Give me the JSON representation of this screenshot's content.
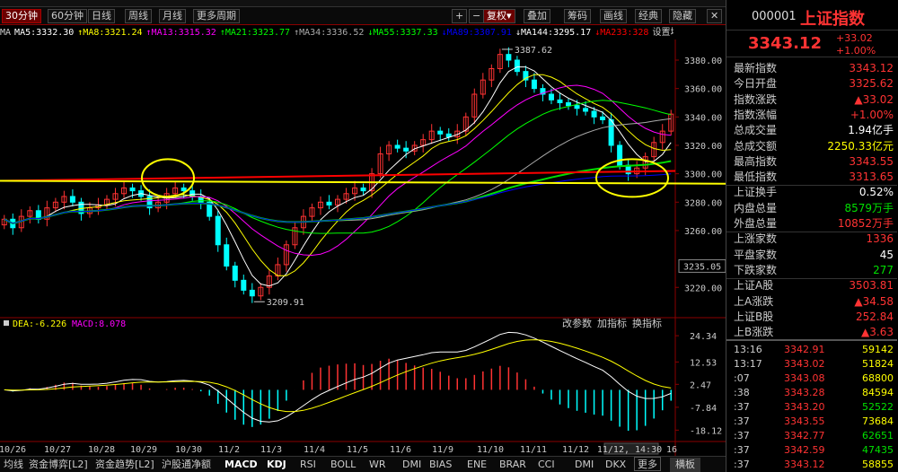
{
  "colors": {
    "up": "#ff3333",
    "down": "#00ffff",
    "highlight": "#ffff00",
    "ma5": "#ffffff",
    "ma8": "#ffff00",
    "ma13": "#ff00ff",
    "ma21": "#00ff00",
    "ma34": "#aaaaaa",
    "ma55": "#ffff00",
    "ma89": "#0000ff",
    "ma144": "#ffffff",
    "ma233": "#ff0000"
  },
  "toolbar": {
    "tabs": [
      "30分钟",
      "60分钟",
      "日线",
      "周线",
      "月线",
      "更多周期"
    ],
    "active_tab": "30分钟",
    "right": [
      "+",
      "−",
      "复权",
      "叠加",
      "筹码",
      "画线",
      "经典",
      "隐藏"
    ],
    "fuquan_arrow": "▾",
    "close": "✕"
  },
  "ma_labels": [
    {
      "text": "MA",
      "color": "#ccc"
    },
    {
      "text": "MA5:3332.30",
      "color": "#ffffff"
    },
    {
      "text": "↑MA8:3321.24",
      "color": "#ffff00"
    },
    {
      "text": "↑MA13:3315.32",
      "color": "#ff00ff"
    },
    {
      "text": "↑MA21:3323.77",
      "color": "#00ff00"
    },
    {
      "text": "↑MA34:3336.52",
      "color": "#aaaaaa"
    },
    {
      "text": "↓MA55:3337.33",
      "color": "#00ff00"
    },
    {
      "text": "↓MA89:3307.91",
      "color": "#0000ff"
    },
    {
      "text": "↓MA144:3295.17",
      "color": "#ffffff"
    },
    {
      "text": "↓MA233:328",
      "color": "#ff0000"
    },
    {
      "text": "设置均线",
      "color": "#ccc"
    }
  ],
  "chart_data": {
    "type": "candlestick",
    "main_axis": {
      "ticks": [
        3380,
        3360,
        3340,
        3320,
        3300,
        3280,
        3260,
        3220
      ],
      "labels": [
        "3380.00",
        "3360.00",
        "3340.00",
        "3320.00",
        "3300.00",
        "3280.00",
        "3260.00",
        "3220.00"
      ],
      "marker": "3235.05",
      "ylim": [
        3205,
        3392
      ]
    },
    "high_label": "3387.62",
    "low_label": "3209.91",
    "x_labels": [
      "10/26",
      "10/27",
      "10/28",
      "10/29",
      "10/30",
      "11/2",
      "11/3",
      "11/4",
      "11/5",
      "11/6",
      "11/9",
      "11/10",
      "11/11",
      "11/12",
      "11/12, 14:30",
      "16"
    ],
    "closes": [
      3268,
      3262,
      3270,
      3274,
      3268,
      3276,
      3280,
      3284,
      3280,
      3272,
      3276,
      3278,
      3282,
      3286,
      3290,
      3288,
      3284,
      3276,
      3280,
      3286,
      3290,
      3288,
      3284,
      3280,
      3270,
      3250,
      3235,
      3225,
      3218,
      3214,
      3220,
      3228,
      3236,
      3250,
      3262,
      3270,
      3276,
      3280,
      3278,
      3282,
      3286,
      3290,
      3288,
      3300,
      3314,
      3320,
      3318,
      3316,
      3320,
      3324,
      3330,
      3328,
      3326,
      3330,
      3340,
      3356,
      3366,
      3374,
      3384,
      3380,
      3372,
      3366,
      3360,
      3356,
      3352,
      3350,
      3348,
      3346,
      3344,
      3340,
      3338,
      3320,
      3306,
      3300,
      3304,
      3312,
      3322,
      3330,
      3342
    ],
    "macd": {
      "legend": [
        {
          "text": "DEA:-6.226",
          "color": "#ffff00"
        },
        {
          "text": "MACD:8.078",
          "color": "#ff00ff"
        }
      ],
      "axis": [
        "24.34",
        "12.53",
        "2.47",
        "-7.84",
        "-18.12"
      ],
      "ylim": [
        -20,
        26
      ],
      "links": [
        "改参数",
        "加指标",
        "换指标"
      ]
    }
  },
  "bottom_tabs": [
    "均线",
    "资金博弈[L2]",
    "资金趋势[L2]",
    "沪股通净额",
    "MACD",
    "KDJ",
    "RSI",
    "BOLL",
    "WR",
    "DMI",
    "BIAS",
    "ENE",
    "BRAR",
    "CCI",
    "DMI",
    "DKX",
    "更多",
    "横板"
  ],
  "bottom_active": [
    "MACD",
    "KDJ"
  ],
  "right_panel": {
    "code": "000001",
    "name": "上证指数",
    "price": "3343.12",
    "change": "+33.02",
    "pct": "+1.00%",
    "stats": [
      {
        "label": "最新指数",
        "value": "3343.12",
        "color": "red"
      },
      {
        "label": "今日开盘",
        "value": "3325.62",
        "color": "red"
      },
      {
        "label": "指数涨跌",
        "value": "▲33.02",
        "color": "red"
      },
      {
        "label": "指数涨幅",
        "value": "+1.00%",
        "color": "red"
      },
      {
        "label": "总成交量",
        "value": "1.94亿手",
        "color": "white"
      },
      {
        "label": "总成交额",
        "value": "2250.33亿元",
        "color": "yel"
      },
      {
        "label": "最高指数",
        "value": "3343.55",
        "color": "red"
      },
      {
        "label": "最低指数",
        "value": "3313.65",
        "color": "red"
      },
      {
        "label": "上证换手",
        "value": "0.52%",
        "color": "white"
      },
      {
        "label": "内盘总量",
        "value": "8579万手",
        "color": "green"
      },
      {
        "label": "外盘总量",
        "value": "10852万手",
        "color": "red"
      },
      {
        "label": "上涨家数",
        "value": "1336",
        "color": "red"
      },
      {
        "label": "平盘家数",
        "value": "45",
        "color": "white"
      },
      {
        "label": "下跌家数",
        "value": "277",
        "color": "green"
      },
      {
        "label": "上证A股",
        "value": "3503.81",
        "color": "red"
      },
      {
        "label": "上A涨跌",
        "value": "▲34.58",
        "color": "red"
      },
      {
        "label": "上证B股",
        "value": "252.84",
        "color": "red"
      },
      {
        "label": "上B涨跌",
        "value": "▲3.63",
        "color": "red"
      }
    ],
    "ticks": [
      {
        "t": "13:16",
        "p": "3342.91",
        "v": "59142",
        "pc": "red",
        "vc": "yel"
      },
      {
        "t": "13:17",
        "p": "3343.02",
        "v": "51824",
        "pc": "red",
        "vc": "yel"
      },
      {
        "t": ":07",
        "p": "3343.08",
        "v": "68800",
        "pc": "red",
        "vc": "yel"
      },
      {
        "t": ":38",
        "p": "3343.28",
        "v": "84594",
        "pc": "red",
        "vc": "yel"
      },
      {
        "t": ":37",
        "p": "3343.20",
        "v": "52522",
        "pc": "red",
        "vc": "green"
      },
      {
        "t": ":37",
        "p": "3343.55",
        "v": "73684",
        "pc": "red",
        "vc": "yel"
      },
      {
        "t": ":37",
        "p": "3342.77",
        "v": "62651",
        "pc": "red",
        "vc": "green"
      },
      {
        "t": ":37",
        "p": "3342.59",
        "v": "47435",
        "pc": "red",
        "vc": "green"
      },
      {
        "t": ":37",
        "p": "3343.12",
        "v": "58855",
        "pc": "red",
        "vc": "yel"
      }
    ]
  }
}
